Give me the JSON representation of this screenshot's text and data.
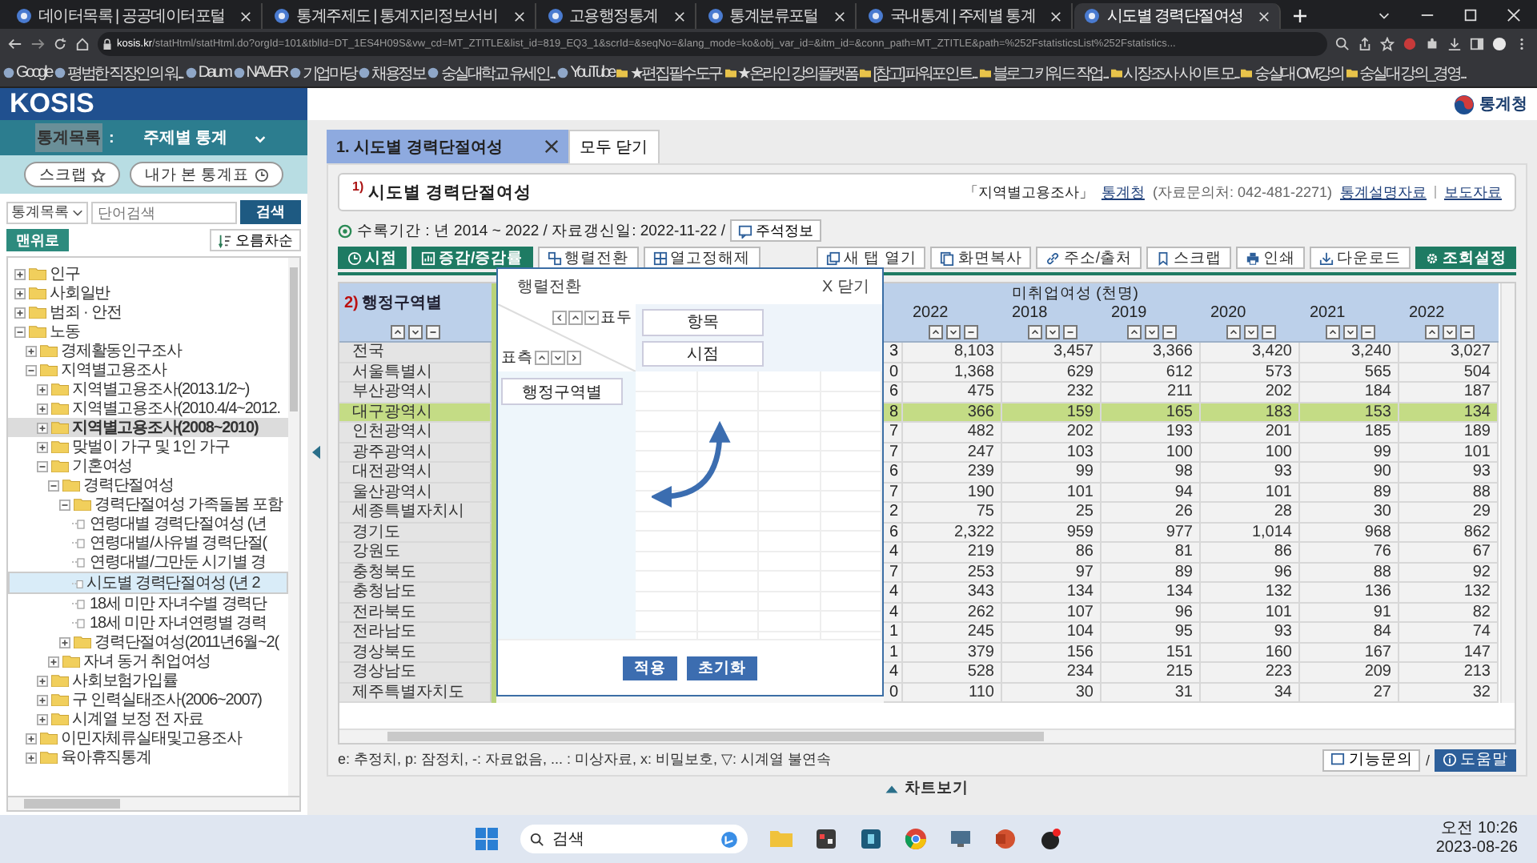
{
  "browser": {
    "tabs": [
      {
        "title": "데이터목록 | 공공데이터포털",
        "selected": false
      },
      {
        "title": "통계주제도 | 통계지리정보서비",
        "selected": false
      },
      {
        "title": "고용행정통계",
        "selected": false
      },
      {
        "title": "통계분류포털",
        "selected": false
      },
      {
        "title": "국내통계 | 주제별 통계",
        "selected": false
      },
      {
        "title": "시도별 경력단절여성",
        "selected": true
      }
    ],
    "address": {
      "domain": "kosis.kr",
      "path": "/statHtml/statHtml.do?orgId=101&tblId=DT_1ES4H09S&vw_cd=MT_ZTITLE&list_id=819_EQ3_1&scrId=&seqNo=&lang_mode=ko&obj_var_id=&itm_id=&conn_path=MT_ZTITLE&path=%252FstatisticsList%252Fstatistics..."
    },
    "bookmarks": [
      {
        "label": "Google",
        "kind": "site"
      },
      {
        "label": "평범한 직장인의 워...",
        "kind": "site"
      },
      {
        "label": "Daum",
        "kind": "site"
      },
      {
        "label": "NAVER",
        "kind": "site"
      },
      {
        "label": "기업마당",
        "kind": "site"
      },
      {
        "label": "채용정보",
        "kind": "site"
      },
      {
        "label": "숭실대학교 유세인...",
        "kind": "site"
      },
      {
        "label": "YouTube",
        "kind": "site"
      },
      {
        "label": "★편집필수도구",
        "kind": "folder"
      },
      {
        "label": "★온라인 강의플랫폼",
        "kind": "folder"
      },
      {
        "label": "[참고] 파워포인트...",
        "kind": "folder"
      },
      {
        "label": "블로그 키워드 작업...",
        "kind": "folder"
      },
      {
        "label": "시장조사 사이트 모...",
        "kind": "folder"
      },
      {
        "label": "숭실대 OM강의",
        "kind": "folder"
      },
      {
        "label": "숭실대 강의_경영...",
        "kind": "folder"
      }
    ]
  },
  "sidebar": {
    "logo": "KOSIS",
    "menu_label": "통계목록",
    "menu_sep": ":",
    "menu_value": "주제별 통계",
    "buttons": [
      {
        "label": "스크랩",
        "kind": "star"
      },
      {
        "label": "내가 본 통계표",
        "kind": "clock"
      }
    ],
    "search": {
      "scope": "통계목록",
      "placeholder": "단어검색",
      "button": "검색"
    },
    "top_button": "맨위로",
    "sort_button": "오름차순",
    "tree": [
      {
        "label": "인구",
        "kind": "folder",
        "expanded": false,
        "selected": false,
        "bold": false
      },
      {
        "label": "사회일반",
        "kind": "folder",
        "expanded": false,
        "selected": false,
        "bold": false
      },
      {
        "label": "범죄 · 안전",
        "kind": "folder",
        "expanded": false,
        "selected": false,
        "bold": false
      },
      {
        "label": "노동",
        "kind": "folder",
        "expanded": true,
        "selected": false,
        "bold": false,
        "children": [
          {
            "label": "경제활동인구조사",
            "kind": "folder",
            "expanded": false,
            "selected": false,
            "bold": false
          },
          {
            "label": "지역별고용조사",
            "kind": "folder",
            "expanded": true,
            "selected": false,
            "bold": false,
            "children": [
              {
                "label": "지역별고용조사(2013.1/2~)",
                "kind": "folder",
                "expanded": false,
                "selected": false,
                "bold": false
              },
              {
                "label": "지역별고용조사(2010.4/4~2012.",
                "kind": "folder",
                "expanded": false,
                "selected": false,
                "bold": false
              },
              {
                "label": "지역별고용조사(2008~2010)",
                "kind": "folder",
                "expanded": false,
                "selected": false,
                "bold": true
              },
              {
                "label": "맞벌이 가구 및 1인 가구",
                "kind": "folder",
                "expanded": false,
                "selected": false,
                "bold": false
              },
              {
                "label": "기혼여성",
                "kind": "folder",
                "expanded": true,
                "selected": false,
                "bold": false,
                "children": [
                  {
                    "label": "경력단절여성",
                    "kind": "folder",
                    "expanded": true,
                    "selected": false,
                    "bold": false,
                    "children": [
                      {
                        "label": "경력단절여성 가족돌봄 포함",
                        "kind": "folder",
                        "expanded": true,
                        "selected": false,
                        "bold": false,
                        "children": [
                          {
                            "label": "연령대별 경력단절여성 (년",
                            "kind": "document",
                            "selected": false,
                            "bold": false
                          },
                          {
                            "label": "연령대별/사유별 경력단절(",
                            "kind": "document",
                            "selected": false,
                            "bold": false
                          },
                          {
                            "label": "연령대별/그만둔 시기별 경",
                            "kind": "document",
                            "selected": false,
                            "bold": false
                          },
                          {
                            "label": "시도별 경력단절여성 (년 2",
                            "kind": "document",
                            "selected": true,
                            "bold": false
                          },
                          {
                            "label": "18세 미만 자녀수별 경력단",
                            "kind": "document",
                            "selected": false,
                            "bold": false
                          },
                          {
                            "label": "18세 미만 자녀연령별 경력",
                            "kind": "document",
                            "selected": false,
                            "bold": false
                          }
                        ]
                      },
                      {
                        "label": "경력단절여성(2011년6월~2(",
                        "kind": "folder",
                        "expanded": false,
                        "selected": false,
                        "bold": false
                      }
                    ]
                  },
                  {
                    "label": "자녀 동거 취업여성",
                    "kind": "folder",
                    "expanded": false,
                    "selected": false,
                    "bold": false
                  }
                ]
              },
              {
                "label": "사회보험가입률",
                "kind": "folder",
                "expanded": false,
                "selected": false,
                "bold": false
              },
              {
                "label": "구 인력실태조사(2006~2007)",
                "kind": "folder",
                "expanded": false,
                "selected": false,
                "bold": false
              },
              {
                "label": "시계열 보정 전 자료",
                "kind": "folder",
                "expanded": false,
                "selected": false,
                "bold": false
              }
            ]
          },
          {
            "label": "이민자체류실태및고용조사",
            "kind": "folder",
            "expanded": false,
            "selected": false,
            "bold": false
          },
          {
            "label": "육아휴직통계",
            "kind": "folder",
            "expanded": false,
            "selected": false,
            "bold": false
          }
        ]
      }
    ]
  },
  "header": {
    "org": "통계청"
  },
  "tabs": [
    {
      "label": "1. 시도별 경력단절여성",
      "selected": true
    }
  ],
  "close_all": "모두 닫기",
  "title": "$^{1)}$ 시도별 경력단절여성",
  "source": {
    "survey": "「지역별고용조사」",
    "org_link": "통계청",
    "contact": "(자료문의처: 042-481-2271)",
    "links": [
      "통계설명자료",
      "보도자료"
    ]
  },
  "info": {
    "text": "수록기간 : 년 2014 ~ 2022 / 자료갱신일: 2022-11-22 /",
    "button": "주석정보"
  },
  "toolbar_left": [
    {
      "label": "시점",
      "kind": "clock"
    },
    {
      "label": "증감/증감률",
      "kind": "chart"
    },
    {
      "label": "행렬전환",
      "kind": "swap"
    },
    {
      "label": "열고정해제",
      "kind": "grid"
    }
  ],
  "toolbar_right": [
    {
      "label": "새 탭 열기",
      "kind": "tab"
    },
    {
      "label": "화면복사",
      "kind": "copy"
    },
    {
      "label": "주소/출처",
      "kind": "link"
    },
    {
      "label": "스크랩",
      "kind": "bookmark"
    },
    {
      "label": "인쇄",
      "kind": "print"
    },
    {
      "label": "다운로드",
      "kind": "download"
    },
    {
      "label": "조회설정",
      "kind": "settings"
    }
  ],
  "table": {
    "row_header_note": "2)",
    "row_header": "행정구역별",
    "group_header": "미취업여성 (천명)",
    "pre_group_years": [
      "2022"
    ],
    "group_years": [
      "2018",
      "2019",
      "2020",
      "2021",
      "2022"
    ],
    "rows": [
      {
        "name": "전국",
        "selected": false,
        "column_2": "3",
        "values": [
          "8,103",
          "3,457",
          "3,366",
          "3,420",
          "3,240",
          "3,027"
        ]
      },
      {
        "name": "서울특별시",
        "selected": false,
        "column_2": "0",
        "values": [
          "1,368",
          "629",
          "612",
          "573",
          "565",
          "504"
        ]
      },
      {
        "name": "부산광역시",
        "selected": false,
        "column_2": "6",
        "values": [
          "475",
          "232",
          "211",
          "202",
          "184",
          "187"
        ]
      },
      {
        "name": "대구광역시",
        "selected": true,
        "column_2": "8",
        "values": [
          "366",
          "159",
          "165",
          "183",
          "153",
          "134"
        ]
      },
      {
        "name": "인천광역시",
        "selected": false,
        "column_2": "7",
        "values": [
          "482",
          "202",
          "193",
          "201",
          "185",
          "189"
        ]
      },
      {
        "name": "광주광역시",
        "selected": false,
        "column_2": "7",
        "values": [
          "247",
          "103",
          "100",
          "100",
          "99",
          "101"
        ]
      },
      {
        "name": "대전광역시",
        "selected": false,
        "column_2": "6",
        "values": [
          "239",
          "99",
          "98",
          "93",
          "90",
          "93"
        ]
      },
      {
        "name": "울산광역시",
        "selected": false,
        "column_2": "7",
        "values": [
          "190",
          "101",
          "94",
          "101",
          "89",
          "88"
        ]
      },
      {
        "name": "세종특별자치시",
        "selected": false,
        "column_2": "2",
        "values": [
          "75",
          "25",
          "26",
          "28",
          "30",
          "29"
        ]
      },
      {
        "name": "경기도",
        "selected": false,
        "column_2": "6",
        "values": [
          "2,322",
          "959",
          "977",
          "1,014",
          "968",
          "862"
        ]
      },
      {
        "name": "강원도",
        "selected": false,
        "column_2": "4",
        "values": [
          "219",
          "86",
          "81",
          "86",
          "76",
          "67"
        ]
      },
      {
        "name": "충청북도",
        "selected": false,
        "column_2": "7",
        "values": [
          "253",
          "97",
          "89",
          "96",
          "88",
          "92"
        ]
      },
      {
        "name": "충청남도",
        "selected": false,
        "column_2": "4",
        "values": [
          "343",
          "134",
          "134",
          "132",
          "136",
          "132"
        ]
      },
      {
        "name": "전라북도",
        "selected": false,
        "column_2": "4",
        "values": [
          "262",
          "107",
          "96",
          "101",
          "91",
          "82"
        ]
      },
      {
        "name": "전라남도",
        "selected": false,
        "column_2": "1",
        "values": [
          "245",
          "104",
          "95",
          "93",
          "84",
          "74"
        ]
      },
      {
        "name": "경상북도",
        "selected": false,
        "column_2": "1",
        "values": [
          "379",
          "156",
          "151",
          "160",
          "167",
          "147"
        ]
      },
      {
        "name": "경상남도",
        "selected": false,
        "column_2": "4",
        "values": [
          "528",
          "234",
          "215",
          "223",
          "209",
          "213"
        ]
      },
      {
        "name": "제주특별자치도",
        "selected": false,
        "column_2": "0",
        "values": [
          "110",
          "30",
          "31",
          "34",
          "27",
          "32"
        ]
      }
    ]
  },
  "dialog": {
    "title": "행렬전환",
    "close": "X 닫기",
    "column_axis": {
      "label": "표두",
      "items": [
        "항목",
        "시점"
      ]
    },
    "row_axis": {
      "label": "표측",
      "items": [
        "행정구역별"
      ]
    },
    "buttons": [
      "적용",
      "초기화"
    ]
  },
  "legend": "e: 추정치, p: 잠정치, -: 자료없음, ... : 미상자료, x: 비밀보호, ▽: 시계열 불연속",
  "help": {
    "inquiry": "기능문의",
    "sep": "/",
    "help": "도움말"
  },
  "chart_toggle": "차트보기",
  "taskbar": {
    "search": "검색",
    "time": "오전 10:26",
    "date": "2023-08-26"
  }
}
